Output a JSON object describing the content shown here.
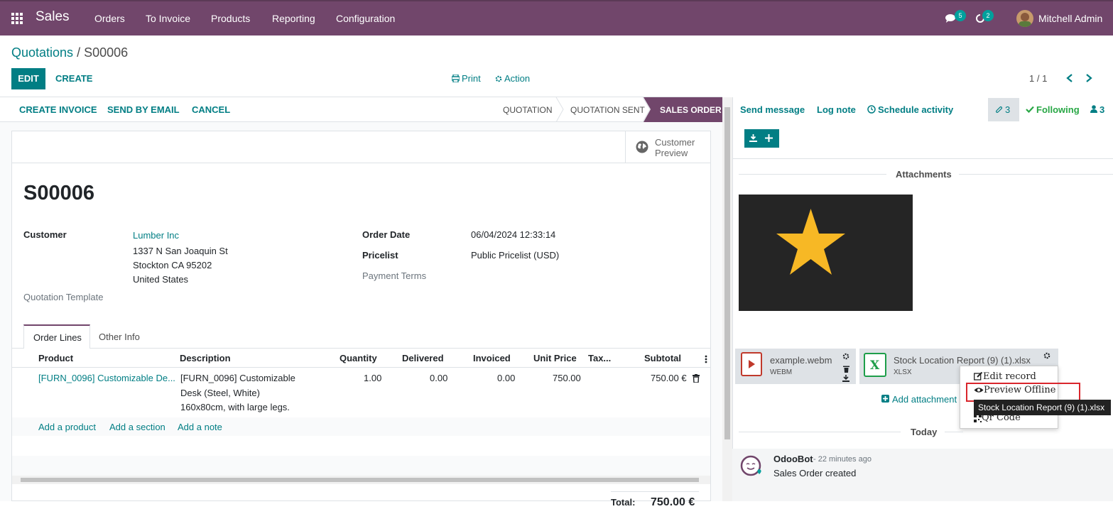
{
  "nav": {
    "brand": "Sales",
    "menu": [
      "Orders",
      "To Invoice",
      "Products",
      "Reporting",
      "Configuration"
    ],
    "messages_count": "5",
    "activities_count": "2",
    "user": "Mitchell Admin"
  },
  "breadcrumb": {
    "parent": "Quotations",
    "separator": " / ",
    "current": "S00006"
  },
  "control": {
    "edit": "EDIT",
    "create": "CREATE",
    "print": "Print",
    "action": "Action",
    "pager": "1 / 1"
  },
  "statusbar": {
    "buttons": [
      "CREATE INVOICE",
      "SEND BY EMAIL",
      "CANCEL"
    ],
    "stages": [
      "QUOTATION",
      "QUOTATION SENT",
      "SALES ORDER"
    ]
  },
  "form": {
    "preview_line1": "Customer",
    "preview_line2": "Preview",
    "name": "S00006",
    "customer_label": "Customer",
    "customer_name": "Lumber Inc",
    "address": [
      "1337 N San Joaquin St",
      "Stockton CA 95202",
      "United States"
    ],
    "template_label": "Quotation Template",
    "order_date_label": "Order Date",
    "order_date": "06/04/2024 12:33:14",
    "pricelist_label": "Pricelist",
    "pricelist": "Public Pricelist (USD)",
    "payment_terms_label": "Payment Terms",
    "tabs": [
      "Order Lines",
      "Other Info"
    ],
    "columns": [
      "Product",
      "Description",
      "Quantity",
      "Delivered",
      "Invoiced",
      "Unit Price",
      "Tax...",
      "Subtotal"
    ],
    "line": {
      "product": "[FURN_0096] Customizable De...",
      "description": [
        "[FURN_0096] Customizable",
        "Desk (Steel, White)",
        "160x80cm, with large legs."
      ],
      "quantity": "1.00",
      "delivered": "0.00",
      "invoiced": "0.00",
      "unit_price": "750.00",
      "subtotal": "750.00 €"
    },
    "add_links": [
      "Add a product",
      "Add a section",
      "Add a note"
    ],
    "total_label": "Total:",
    "total_value": "750.00 €"
  },
  "chatter": {
    "send_message": "Send message",
    "log_note": "Log note",
    "schedule": "Schedule activity",
    "attach_count": "3",
    "following": "Following",
    "followers_count": "3",
    "attachments_title": "Attachments",
    "files": [
      {
        "name": "example.webm",
        "ext": "WEBM"
      },
      {
        "name": "Stock Location Report (9) (1).xlsx",
        "ext": "XLSX"
      }
    ],
    "menu": [
      "Edit record",
      "Preview Offline",
      "Qr Code"
    ],
    "tooltip": "Stock Location Report (9) (1).xlsx",
    "add_attachment": "Add attachment",
    "today": "Today",
    "msg_author": "OdooBot",
    "msg_time": "- 22 minutes ago",
    "msg_body": "Sales Order created"
  },
  "colors": {
    "nav": "#71466b",
    "accent": "#017e84",
    "star": "#f7b825",
    "stage_active": "#71466b"
  }
}
